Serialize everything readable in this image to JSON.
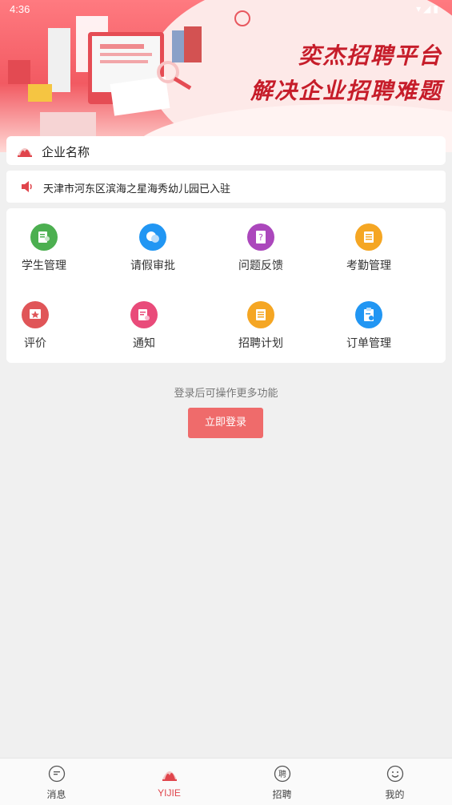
{
  "status_bar": {
    "time": "4:36"
  },
  "banner": {
    "title_line1": "奕杰招聘平台",
    "title_line2": "解决企业招聘难题"
  },
  "company": {
    "name": "企业名称"
  },
  "notice": {
    "text": "天津市河东区滨海之星海秀幼儿园已入驻"
  },
  "features": [
    {
      "label": "学生管理",
      "icon": "student-icon",
      "color": "#4caf50"
    },
    {
      "label": "请假审批",
      "icon": "chat-bubbles-icon",
      "color": "#2196f3"
    },
    {
      "label": "问题反馈",
      "icon": "question-doc-icon",
      "color": "#ab47bc"
    },
    {
      "label": "考勤管理",
      "icon": "attendance-doc-icon",
      "color": "#f5a623"
    },
    {
      "label": "评价",
      "icon": "star-review-icon",
      "color": "#e05558"
    },
    {
      "label": "通知",
      "icon": "notice-doc-icon",
      "color": "#e94b7a"
    },
    {
      "label": "招聘计划",
      "icon": "plan-list-icon",
      "color": "#f5a623"
    },
    {
      "label": "订单管理",
      "icon": "order-clipboard-icon",
      "color": "#2196f3"
    }
  ],
  "login": {
    "hint": "登录后可操作更多功能",
    "button_label": "立即登录"
  },
  "tabbar": [
    {
      "label": "消息",
      "icon": "message-icon",
      "active": false
    },
    {
      "label": "YIJIE",
      "icon": "yijie-logo-icon",
      "active": true
    },
    {
      "label": "招聘",
      "icon": "recruit-icon",
      "active": false
    },
    {
      "label": "我的",
      "icon": "smile-icon",
      "active": false
    }
  ],
  "colors": {
    "accent": "#e0454c",
    "login_button": "#ef6b6b"
  }
}
